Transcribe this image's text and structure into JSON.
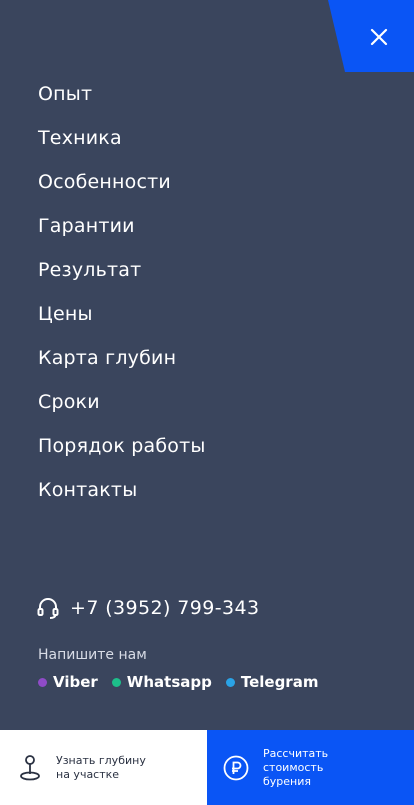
{
  "menu": {
    "close_icon": "close-icon",
    "items": [
      "Опыт",
      "Техника",
      "Особенности",
      "Гарантии",
      "Результат",
      "Цены",
      "Карта глубин",
      "Сроки",
      "Порядок работы",
      "Контакты"
    ]
  },
  "contacts": {
    "phone_icon": "headset-icon",
    "phone": "+7 (3952) 799-343",
    "write_us": "Напишите нам",
    "messengers": [
      {
        "name": "Viber",
        "color": "#8f4bc7"
      },
      {
        "name": "Whatsapp",
        "color": "#1dbf8a"
      },
      {
        "name": "Telegram",
        "color": "#2aa3e6"
      }
    ]
  },
  "bottom": {
    "depth_label": "Узнать глубину\nна участке",
    "calc_label": "Рассчитать\nстоимость бурения"
  },
  "colors": {
    "panel": "#3a455d",
    "accent": "#0a55f5"
  }
}
